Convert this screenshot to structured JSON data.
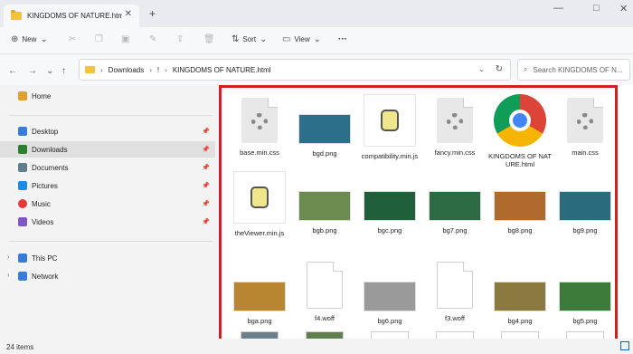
{
  "window": {
    "tab_title": "KINGDOMS OF NATURE.html",
    "tab_close": "✕",
    "new_tab": "+",
    "minimize": "—",
    "maximize": "□",
    "close": "✕"
  },
  "toolbar": {
    "new_label": "New",
    "sort_label": "Sort",
    "view_label": "View",
    "more_label": "···"
  },
  "address": {
    "crumbs": [
      "Downloads",
      "!",
      "KINGDOMS OF NATURE.html"
    ],
    "search_placeholder": "Search KINGDOMS OF N..."
  },
  "sidebar": {
    "home": "Home",
    "quick_access": [
      {
        "label": "Desktop",
        "color": "#3a7bd5"
      },
      {
        "label": "Downloads",
        "color": "#2e7d32"
      },
      {
        "label": "Documents",
        "color": "#607d8b"
      },
      {
        "label": "Pictures",
        "color": "#1e88e5"
      },
      {
        "label": "Music",
        "color": "#e53935"
      },
      {
        "label": "Videos",
        "color": "#7e57c2"
      }
    ],
    "this_pc": "This PC",
    "network": "Network"
  },
  "files": [
    {
      "name": "base.min.css",
      "kind": "css"
    },
    {
      "name": "bgd.png",
      "kind": "img",
      "color": "#2b6f8a"
    },
    {
      "name": "compatibility.min.js",
      "kind": "js"
    },
    {
      "name": "fancy.min.css",
      "kind": "css"
    },
    {
      "name": "KINGDOMS OF NATURE.html",
      "kind": "chrome"
    },
    {
      "name": "main.css",
      "kind": "css"
    },
    {
      "name": "theViewer.min.js",
      "kind": "js"
    },
    {
      "name": "bgb.png",
      "kind": "img",
      "color": "#6b8b4f"
    },
    {
      "name": "bgc.png",
      "kind": "img",
      "color": "#1f5f3a"
    },
    {
      "name": "bg7.png",
      "kind": "img",
      "color": "#2d6b45"
    },
    {
      "name": "bg8.png",
      "kind": "img",
      "color": "#b06a2e"
    },
    {
      "name": "bg9.png",
      "kind": "img",
      "color": "#2a6b7d"
    },
    {
      "name": "bga.png",
      "kind": "img",
      "color": "#b88530"
    },
    {
      "name": "f4.woff",
      "kind": "blank"
    },
    {
      "name": "bg6.png",
      "kind": "img",
      "color": "#9a9a9a"
    },
    {
      "name": "f3.woff",
      "kind": "blank"
    },
    {
      "name": "bg4.png",
      "kind": "img",
      "color": "#8a7a40"
    },
    {
      "name": "bg5.png",
      "kind": "img",
      "color": "#3c7a3a"
    }
  ],
  "status": {
    "items_count": "24 items"
  }
}
